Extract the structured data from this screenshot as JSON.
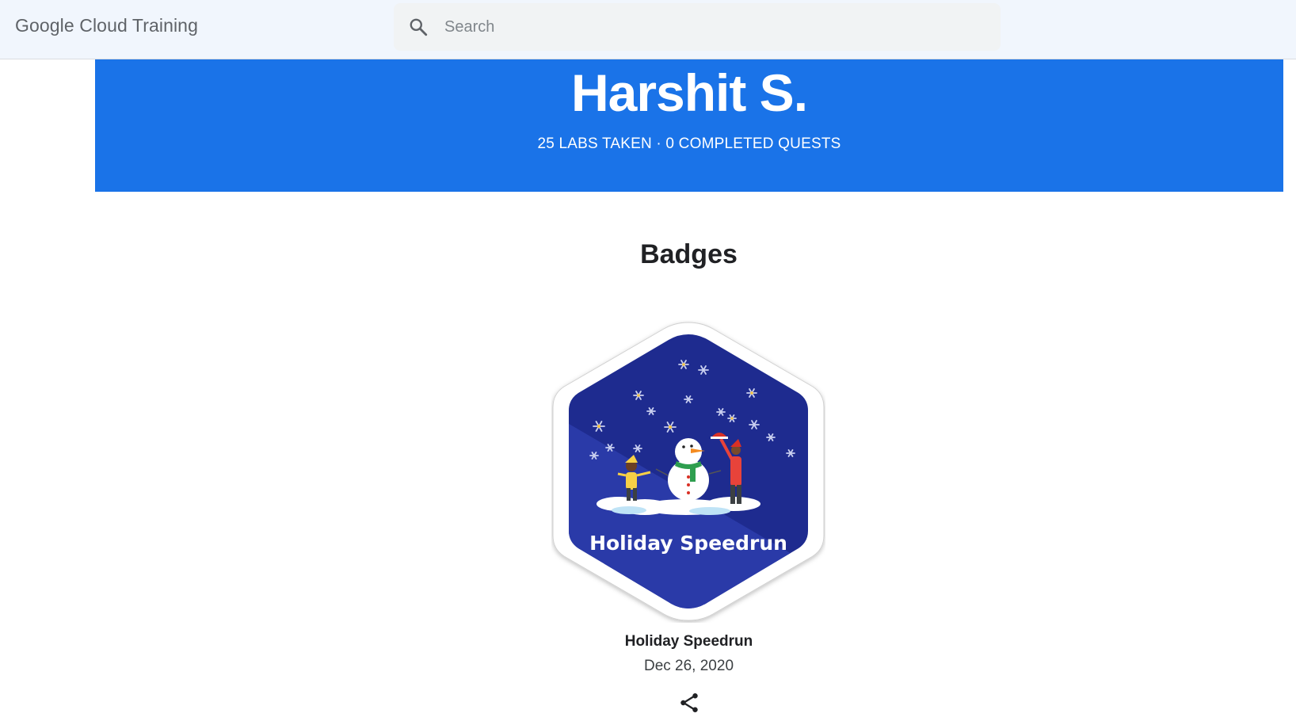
{
  "header": {
    "brand": "Google Cloud Training",
    "search_placeholder": "Search"
  },
  "profile": {
    "name": "Harshit S.",
    "stats": "25 LABS TAKEN · 0 COMPLETED QUESTS"
  },
  "badges": {
    "section_title": "Badges",
    "items": [
      {
        "title": "Holiday Speedrun",
        "date": "Dec 26, 2020",
        "artwork_text": "Holiday Speedrun"
      }
    ]
  },
  "icons": {
    "search": "search-icon",
    "share": "share-icon"
  },
  "colors": {
    "hero": "#1a73e8",
    "badge_bg": "#1f2a8c",
    "badge_border": "#ffffff"
  }
}
